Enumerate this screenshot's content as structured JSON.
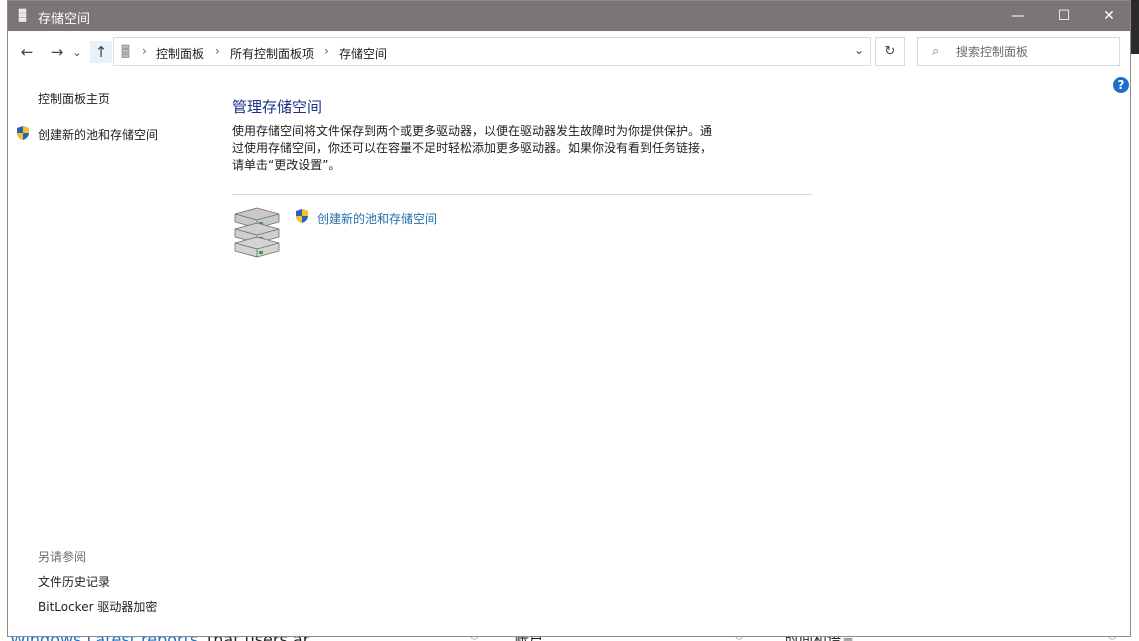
{
  "window": {
    "title": "存储空间",
    "controls": {
      "minimize": "—",
      "maximize": "☐",
      "close": "✕"
    }
  },
  "nav": {
    "back_icon": "←",
    "forward_icon": "→",
    "recent_icon": "⌄",
    "up_icon": "↑",
    "breadcrumb": [
      "控制面板",
      "所有控制面板项",
      "存储空间"
    ],
    "separator": "›",
    "dropdown_icon": "⌄",
    "refresh_icon": "↻"
  },
  "search": {
    "placeholder": "搜索控制面板",
    "value": "",
    "icon": "⌕"
  },
  "help": {
    "label": "?"
  },
  "sidebar": {
    "home": "控制面板主页",
    "create": "创建新的池和存储空间",
    "see_also_title": "另请参阅",
    "see_also": [
      "文件历史记录",
      "BitLocker 驱动器加密"
    ]
  },
  "main": {
    "title": "管理存储空间",
    "description": "使用存储空间将文件保存到两个或更多驱动器，以便在驱动器发生故障时为你提供保护。通过使用存储空间，你还可以在容量不足时轻松添加更多驱动器。如果你没有看到任务链接，请单击“更改设置”。",
    "create_link": "创建新的池和存储空间"
  },
  "background": {
    "link_text": "Windows Latest reports",
    "trail_text": "that users ar",
    "item1": "帐户",
    "item2": "时间和语言"
  },
  "icons": [
    "storage-spaces-icon",
    "shield-icon",
    "drives-icon",
    "search-icon",
    "help-icon"
  ],
  "colors": {
    "titlebar": "#7b7575",
    "link": "#1f6fa8",
    "heading": "#1e3287",
    "help": "#1e6fc9"
  }
}
